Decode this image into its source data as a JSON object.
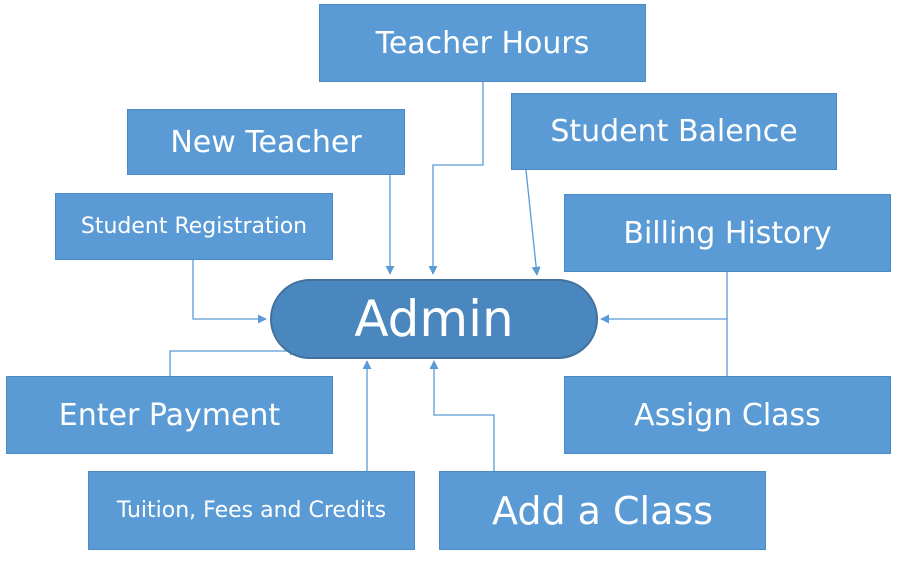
{
  "center": {
    "label": "Admin"
  },
  "nodes": {
    "teacher_hours": "Teacher Hours",
    "new_teacher": "New Teacher",
    "student_balence": "Student Balence",
    "student_registration": "Student Registration",
    "billing_history": "Billing History",
    "enter_payment": "Enter Payment",
    "assign_class": "Assign Class",
    "tuition_fees_credits": "Tuition, Fees and Credits",
    "add_a_class": "Add a Class"
  },
  "colors": {
    "box_fill": "#5b9bd5",
    "center_fill": "#4a87bf",
    "connector": "#5b9bd5",
    "text": "#ffffff"
  }
}
